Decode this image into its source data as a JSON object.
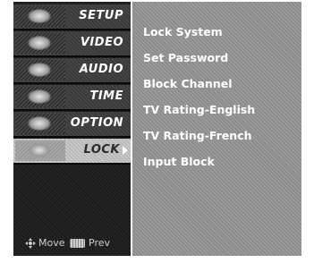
{
  "left_menu": {
    "items": [
      {
        "label": "SETUP",
        "icon": "setup-thumbnail-icon"
      },
      {
        "label": "VIDEO",
        "icon": "video-thumbnail-icon"
      },
      {
        "label": "AUDIO",
        "icon": "audio-thumbnail-icon"
      },
      {
        "label": "TIME",
        "icon": "time-thumbnail-icon"
      },
      {
        "label": "OPTION",
        "icon": "option-thumbnail-icon"
      },
      {
        "label": "LOCK",
        "icon": "lock-thumbnail-icon",
        "selected": true
      }
    ]
  },
  "hints": {
    "move_label": "Move",
    "prev_label": "Prev"
  },
  "lock_menu": {
    "options": [
      "Lock System",
      "Set Password",
      "Block Channel",
      "TV Rating-English",
      "TV Rating-French",
      "Input Block"
    ]
  }
}
